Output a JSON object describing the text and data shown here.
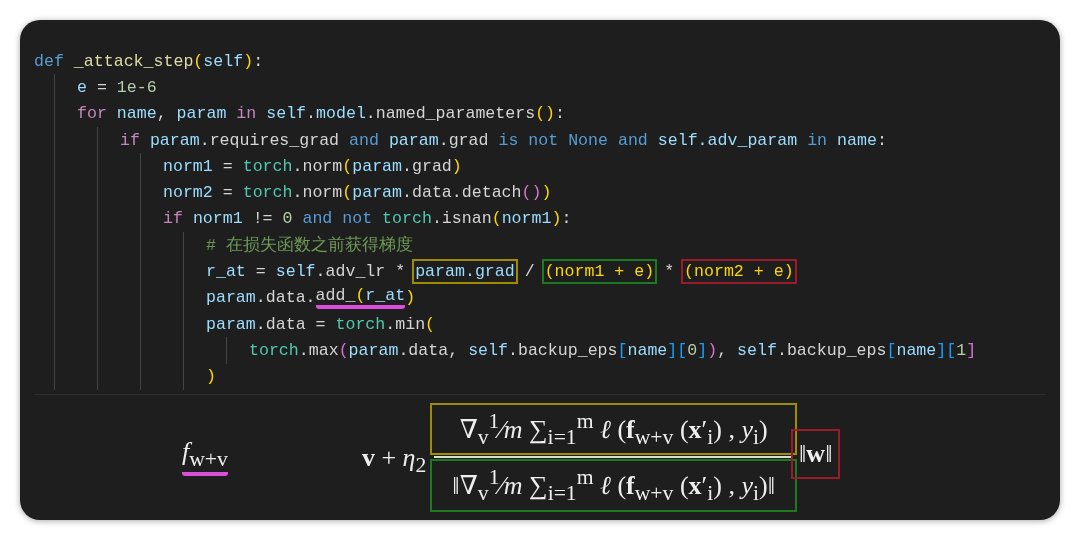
{
  "code": {
    "lines": [
      {
        "segments": [
          {
            "kind": "plain",
            "tokens": [
              {
                "text": "def ",
                "kind": "keyword2"
              },
              {
                "text": "_attack_step",
                "kind": "function"
              },
              {
                "text": "(",
                "kind": "paren"
              },
              {
                "text": "self",
                "kind": "variable"
              },
              {
                "text": ")",
                "kind": "paren"
              },
              {
                "text": ":",
                "kind": "plain"
              }
            ]
          }
        ],
        "children": [
          {
            "segments": [
              {
                "kind": "plain",
                "tokens": [
                  {
                    "text": "e",
                    "kind": "variable"
                  },
                  {
                    "text": " = ",
                    "kind": "plain"
                  },
                  {
                    "text": "1e-6",
                    "kind": "number"
                  }
                ]
              }
            ]
          },
          {
            "segments": [
              {
                "kind": "plain",
                "tokens": [
                  {
                    "text": "for ",
                    "kind": "keyword"
                  },
                  {
                    "text": "name",
                    "kind": "variable"
                  },
                  {
                    "text": ", ",
                    "kind": "plain"
                  },
                  {
                    "text": "param",
                    "kind": "variable"
                  },
                  {
                    "text": " in ",
                    "kind": "keyword"
                  },
                  {
                    "text": "self",
                    "kind": "variable"
                  },
                  {
                    "text": ".",
                    "kind": "plain"
                  },
                  {
                    "text": "model",
                    "kind": "variable"
                  },
                  {
                    "text": ".named_parameters",
                    "kind": "plain"
                  },
                  {
                    "text": "()",
                    "kind": "paren"
                  },
                  {
                    "text": ":",
                    "kind": "plain"
                  }
                ]
              }
            ],
            "children": [
              {
                "segments": [
                  {
                    "kind": "plain",
                    "tokens": [
                      {
                        "text": "if ",
                        "kind": "keyword"
                      },
                      {
                        "text": "param",
                        "kind": "variable"
                      },
                      {
                        "text": ".requires_grad ",
                        "kind": "plain"
                      },
                      {
                        "text": "and ",
                        "kind": "keyword2"
                      },
                      {
                        "text": "param",
                        "kind": "variable"
                      },
                      {
                        "text": ".grad ",
                        "kind": "plain"
                      },
                      {
                        "text": "is not None and ",
                        "kind": "keyword2"
                      },
                      {
                        "text": "self.adv_param",
                        "kind": "variable"
                      },
                      {
                        "text": " in ",
                        "kind": "keyword2"
                      },
                      {
                        "text": "name",
                        "kind": "variable"
                      },
                      {
                        "text": ":",
                        "kind": "plain"
                      }
                    ]
                  }
                ],
                "children": [
                  {
                    "segments": [
                      {
                        "kind": "plain",
                        "tokens": [
                          {
                            "text": "norm1",
                            "kind": "variable"
                          },
                          {
                            "text": " = ",
                            "kind": "plain"
                          },
                          {
                            "text": "torch",
                            "kind": "module"
                          },
                          {
                            "text": ".norm",
                            "kind": "plain"
                          },
                          {
                            "text": "(",
                            "kind": "paren"
                          },
                          {
                            "text": "param",
                            "kind": "variable"
                          },
                          {
                            "text": ".grad",
                            "kind": "plain"
                          },
                          {
                            "text": ")",
                            "kind": "paren"
                          }
                        ]
                      }
                    ]
                  },
                  {
                    "segments": [
                      {
                        "kind": "plain",
                        "tokens": [
                          {
                            "text": "norm2",
                            "kind": "variable"
                          },
                          {
                            "text": " = ",
                            "kind": "plain"
                          },
                          {
                            "text": "torch",
                            "kind": "module"
                          },
                          {
                            "text": ".norm",
                            "kind": "plain"
                          },
                          {
                            "text": "(",
                            "kind": "paren"
                          },
                          {
                            "text": "param",
                            "kind": "variable"
                          },
                          {
                            "text": ".data.detach",
                            "kind": "plain"
                          },
                          {
                            "text": "()",
                            "kind": "paren2"
                          },
                          {
                            "text": ")",
                            "kind": "paren"
                          }
                        ]
                      }
                    ]
                  },
                  {
                    "segments": [
                      {
                        "kind": "plain",
                        "tokens": [
                          {
                            "text": "if ",
                            "kind": "keyword"
                          },
                          {
                            "text": "norm1",
                            "kind": "variable"
                          },
                          {
                            "text": " != ",
                            "kind": "plain"
                          },
                          {
                            "text": "0",
                            "kind": "number"
                          },
                          {
                            "text": " and not ",
                            "kind": "keyword2"
                          },
                          {
                            "text": "torch",
                            "kind": "module"
                          },
                          {
                            "text": ".isnan",
                            "kind": "plain"
                          },
                          {
                            "text": "(",
                            "kind": "paren"
                          },
                          {
                            "text": "norm1",
                            "kind": "variable"
                          },
                          {
                            "text": ")",
                            "kind": "paren"
                          },
                          {
                            "text": ":",
                            "kind": "plain"
                          }
                        ]
                      }
                    ],
                    "children": [
                      {
                        "segments": [
                          {
                            "kind": "plain",
                            "tokens": [
                              {
                                "text": "# 在损失函数之前获得梯度",
                                "kind": "comment"
                              }
                            ]
                          }
                        ]
                      },
                      {
                        "segments": [
                          {
                            "kind": "plain",
                            "tokens": [
                              {
                                "text": "r_at",
                                "kind": "variable"
                              },
                              {
                                "text": " = ",
                                "kind": "plain"
                              },
                              {
                                "text": "self",
                                "kind": "variable"
                              },
                              {
                                "text": ".adv_lr * ",
                                "kind": "plain"
                              }
                            ]
                          },
                          {
                            "kind": "box",
                            "color": "#a08c00",
                            "tokens": [
                              {
                                "text": "param.grad",
                                "kind": "variable"
                              }
                            ]
                          },
                          {
                            "kind": "plain",
                            "tokens": [
                              {
                                "text": " / ",
                                "kind": "plain"
                              }
                            ]
                          },
                          {
                            "kind": "box",
                            "color": "#1e7a1e",
                            "tokens": [
                              {
                                "text": "(norm1 + e)",
                                "kind": "paren"
                              }
                            ]
                          },
                          {
                            "kind": "plain",
                            "tokens": [
                              {
                                "text": " * ",
                                "kind": "plain"
                              }
                            ]
                          },
                          {
                            "kind": "box",
                            "color": "#9a1b2a",
                            "tokens": [
                              {
                                "text": "(norm2 + e)",
                                "kind": "paren"
                              }
                            ]
                          }
                        ]
                      },
                      {
                        "segments": [
                          {
                            "kind": "plain",
                            "tokens": [
                              {
                                "text": "param",
                                "kind": "variable"
                              },
                              {
                                "text": ".data.",
                                "kind": "plain"
                              }
                            ]
                          },
                          {
                            "kind": "underline",
                            "color": "#d94fd9",
                            "tokens": [
                              {
                                "text": "add_",
                                "kind": "plain"
                              },
                              {
                                "text": "(",
                                "kind": "paren"
                              },
                              {
                                "text": "r_at",
                                "kind": "variable"
                              }
                            ]
                          },
                          {
                            "kind": "plain",
                            "tokens": [
                              {
                                "text": ")",
                                "kind": "paren"
                              }
                            ]
                          }
                        ]
                      },
                      {
                        "segments": [
                          {
                            "kind": "plain",
                            "tokens": [
                              {
                                "text": "param",
                                "kind": "variable"
                              },
                              {
                                "text": ".data = ",
                                "kind": "plain"
                              },
                              {
                                "text": "torch",
                                "kind": "module"
                              },
                              {
                                "text": ".min",
                                "kind": "plain"
                              },
                              {
                                "text": "(",
                                "kind": "paren"
                              }
                            ]
                          }
                        ],
                        "children": [
                          {
                            "segments": [
                              {
                                "kind": "plain",
                                "tokens": [
                                  {
                                    "text": "torch",
                                    "kind": "module"
                                  },
                                  {
                                    "text": ".max",
                                    "kind": "plain"
                                  },
                                  {
                                    "text": "(",
                                    "kind": "paren2"
                                  },
                                  {
                                    "text": "param",
                                    "kind": "variable"
                                  },
                                  {
                                    "text": ".data, ",
                                    "kind": "plain"
                                  },
                                  {
                                    "text": "self",
                                    "kind": "variable"
                                  },
                                  {
                                    "text": ".backup_eps",
                                    "kind": "plain"
                                  },
                                  {
                                    "text": "[",
                                    "kind": "bracket"
                                  },
                                  {
                                    "text": "name",
                                    "kind": "variable"
                                  },
                                  {
                                    "text": "][",
                                    "kind": "bracket"
                                  },
                                  {
                                    "text": "0",
                                    "kind": "number"
                                  },
                                  {
                                    "text": "]",
                                    "kind": "bracket"
                                  },
                                  {
                                    "text": ")",
                                    "kind": "paren2"
                                  },
                                  {
                                    "text": ", ",
                                    "kind": "plain"
                                  },
                                  {
                                    "text": "self",
                                    "kind": "variable"
                                  },
                                  {
                                    "text": ".backup_eps",
                                    "kind": "plain"
                                  },
                                  {
                                    "text": "[",
                                    "kind": "bracket"
                                  },
                                  {
                                    "text": "name",
                                    "kind": "variable"
                                  },
                                  {
                                    "text": "][",
                                    "kind": "bracket"
                                  },
                                  {
                                    "text": "1",
                                    "kind": "number"
                                  },
                                  {
                                    "text": "]",
                                    "kind": "paren2"
                                  }
                                ]
                              }
                            ]
                          }
                        ]
                      },
                      {
                        "segments": [
                          {
                            "kind": "plain",
                            "tokens": [
                              {
                                "text": ")",
                                "kind": "paren"
                              }
                            ]
                          }
                        ]
                      }
                    ]
                  }
                ]
              }
            ]
          }
        ]
      }
    ]
  },
  "formula": {
    "left": {
      "text": "*f*$_{w+v}$",
      "kind": "underline",
      "color": "#d94fd9"
    },
    "prefix": "**v** + *η*$_{2}$",
    "numerator": {
      "text": "∇$_{v}$$^{1}$⁄*m* ∑$_{i=1}$$^{m}$ *ℓ* (**f**$_{w+v}$ (**x**′$_{i}$) , *y*$_{i}$)",
      "kind": "box",
      "color": "#a08c00"
    },
    "denominator": {
      "text": "‖∇$_{v}$$^{1}$⁄*m* ∑$_{i=1}$$^{m}$ *ℓ* (**f**$_{w+v}$ (**x**′$_{i}$) , *y*$_{i}$)‖",
      "kind": "box",
      "color": "#1e7a1e"
    },
    "suffix": {
      "text": "‖**w**‖",
      "kind": "box",
      "color": "#9a1b2a"
    }
  }
}
